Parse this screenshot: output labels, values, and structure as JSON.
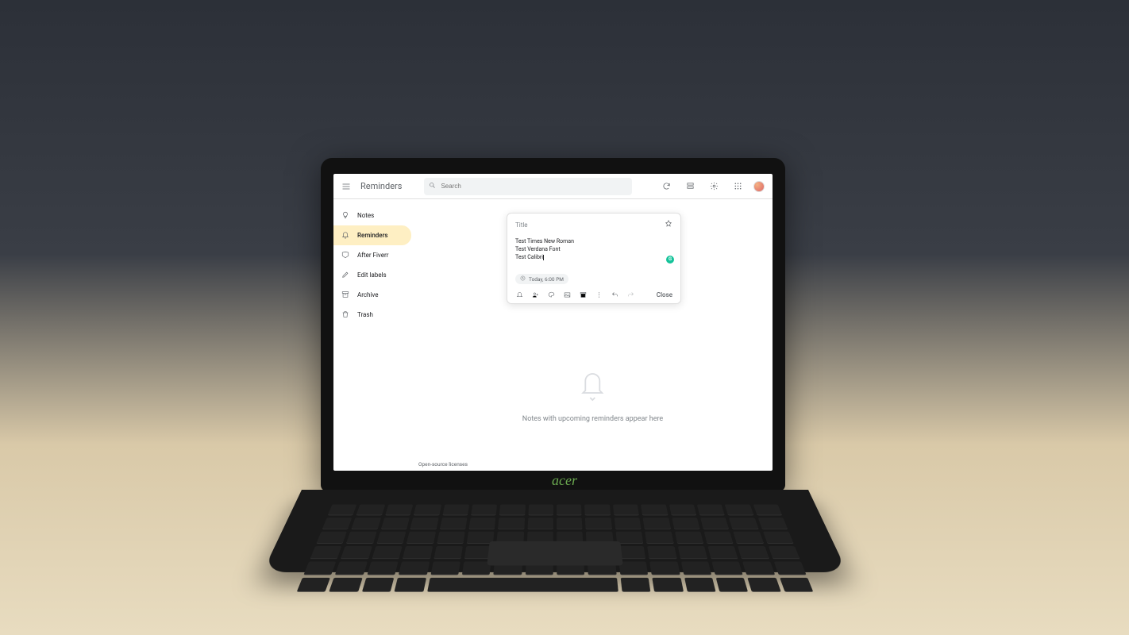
{
  "header": {
    "app_title": "Reminders",
    "search_placeholder": "Search"
  },
  "sidebar": {
    "items": [
      {
        "label": "Notes",
        "icon": "lightbulb"
      },
      {
        "label": "Reminders",
        "icon": "bell",
        "active": true
      },
      {
        "label": "After Fiverr",
        "icon": "tag"
      },
      {
        "label": "Edit labels",
        "icon": "pencil"
      },
      {
        "label": "Archive",
        "icon": "archive"
      },
      {
        "label": "Trash",
        "icon": "trash"
      }
    ]
  },
  "note": {
    "title_placeholder": "Title",
    "body_lines": [
      "Test Times New Roman",
      "Test Verdana Font",
      "Test Calibri"
    ],
    "reminder_chip": "Today, 6:00 PM",
    "close_label": "Close",
    "grammarly_badge": "G"
  },
  "empty_state": {
    "text": "Notes with upcoming reminders appear here"
  },
  "footer": {
    "licenses": "Open-source licenses"
  },
  "laptop_brand": "acer"
}
